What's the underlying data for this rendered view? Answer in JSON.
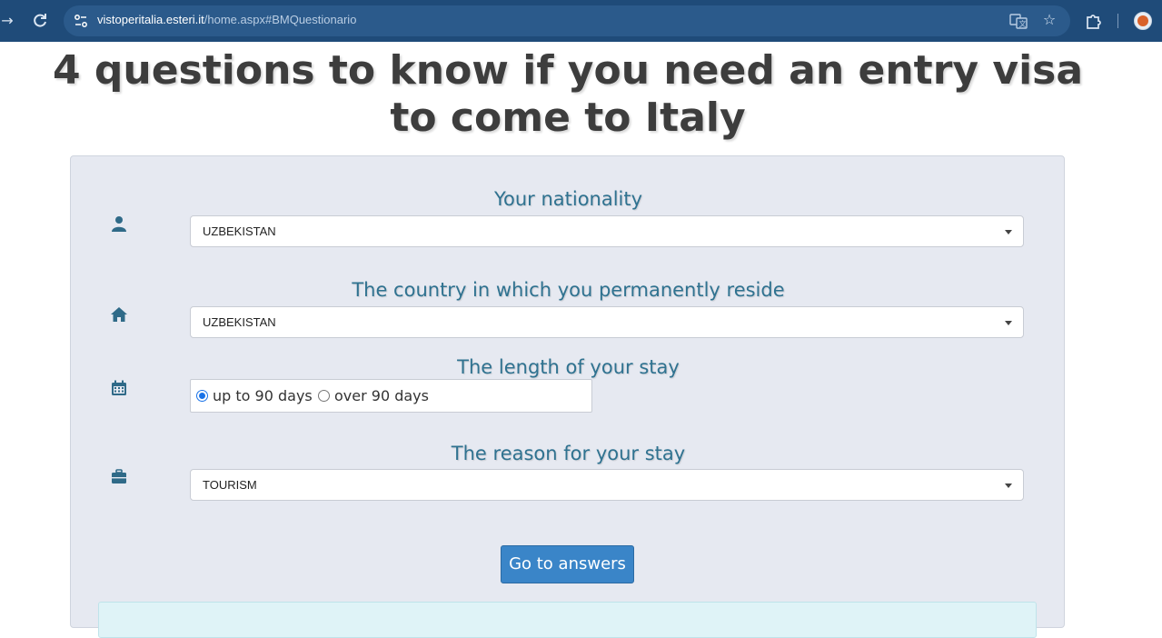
{
  "browser": {
    "url_domain": "vistoperitalia.esteri.it",
    "url_path": "/home.aspx#BMQuestionario",
    "icons": {
      "back": "arrow-right-icon",
      "reload": "reload-icon",
      "site_info": "tune-icon",
      "translate": "translate-icon",
      "bookmark": "star-icon",
      "extensions": "puzzle-icon",
      "profile": "avatar"
    }
  },
  "page": {
    "title": "4 questions to know if you need an entry visa to come to Italy"
  },
  "form": {
    "nationality": {
      "label": "Your nationality",
      "value": "UZBEKISTAN",
      "icon": "user-icon"
    },
    "residence": {
      "label": "The country in which you permanently reside",
      "value": "UZBEKISTAN",
      "icon": "home-icon"
    },
    "stay_length": {
      "label": "The length of your stay",
      "icon": "calendar-icon",
      "options": [
        {
          "label": "up to 90 days",
          "selected": true
        },
        {
          "label": "over 90 days",
          "selected": false
        }
      ]
    },
    "reason": {
      "label": "The reason for your stay",
      "value": "TOURISM",
      "icon": "briefcase-icon"
    },
    "submit_label": "Go to answers"
  },
  "colors": {
    "chrome_bg": "#1f4b79",
    "label": "#2f7290",
    "button": "#3a85c8",
    "panel": "#e6e9f1"
  }
}
